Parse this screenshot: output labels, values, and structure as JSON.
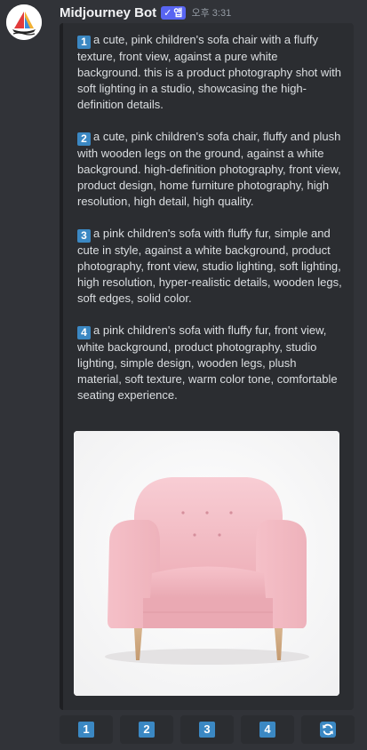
{
  "message": {
    "username": "Midjourney Bot",
    "badge_check": "✓",
    "badge_label": "앱",
    "timestamp": "오후 3:31"
  },
  "prompts": [
    {
      "num": "1",
      "text": "a cute, pink children's sofa chair with a fluffy texture, front view, against a pure white background. this is a product photography shot with soft lighting in a studio, showcasing the high-definition details."
    },
    {
      "num": "2",
      "text": "a cute, pink children's sofa chair, fluffy and plush with wooden legs on the ground, against a white background. high-definition photography, front view, product design, home furniture photography, high resolution, high detail, high quality."
    },
    {
      "num": "3",
      "text": "a pink children's sofa with fluffy fur, simple and cute in style, against a white background, product photography, front view, studio lighting, soft lighting, high resolution, hyper-realistic details, wooden legs, soft edges, solid color."
    },
    {
      "num": "4",
      "text": "a pink children's sofa with fluffy fur, front view, white background, product photography, studio lighting, simple design, wooden legs, plush material, soft texture, warm color tone, comfortable seating experience."
    }
  ],
  "buttons": [
    {
      "label": "1"
    },
    {
      "label": "2"
    },
    {
      "label": "3"
    },
    {
      "label": "4"
    },
    {
      "icon": "refresh-icon"
    }
  ],
  "colors": {
    "background": "#313338",
    "embed": "#2b2d31",
    "keycap": "#3b88c3",
    "app_badge": "#5865f2",
    "sofa_pink": "#f7c4cc"
  }
}
